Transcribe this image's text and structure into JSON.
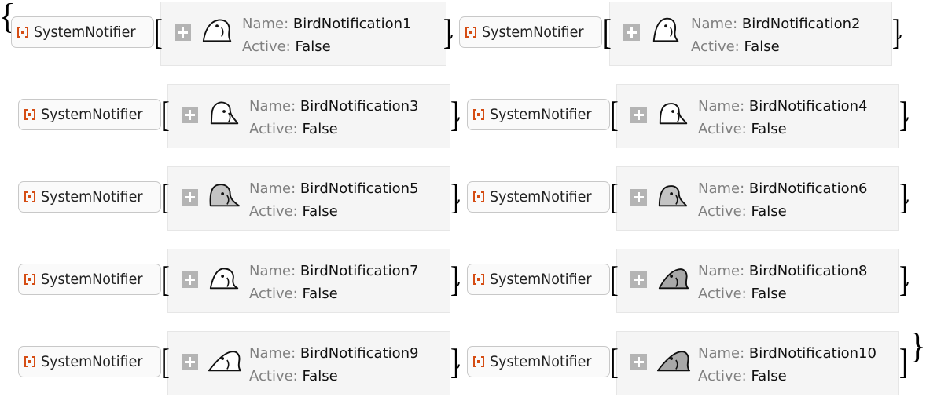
{
  "expression": {
    "open_brace": "{",
    "close_brace": "}",
    "open_bracket": "[",
    "close_bracket": "]",
    "separator": ","
  },
  "colors": {
    "notifier_icon": "#d54d14",
    "panel_background": "#f5f5f5",
    "field_key": "#808080",
    "expand_button": "#b4b4b4"
  },
  "notifiers": [
    {
      "head": "SystemNotifier",
      "name_key": "Name:",
      "name": "BirdNotification1",
      "active_key": "Active:",
      "active": "False",
      "icon": "bird-icon"
    },
    {
      "head": "SystemNotifier",
      "name_key": "Name:",
      "name": "BirdNotification2",
      "active_key": "Active:",
      "active": "False",
      "icon": "bird-icon"
    },
    {
      "head": "SystemNotifier",
      "name_key": "Name:",
      "name": "BirdNotification3",
      "active_key": "Active:",
      "active": "False",
      "icon": "bird-icon"
    },
    {
      "head": "SystemNotifier",
      "name_key": "Name:",
      "name": "BirdNotification4",
      "active_key": "Active:",
      "active": "False",
      "icon": "bird-icon"
    },
    {
      "head": "SystemNotifier",
      "name_key": "Name:",
      "name": "BirdNotification5",
      "active_key": "Active:",
      "active": "False",
      "icon": "bird-icon"
    },
    {
      "head": "SystemNotifier",
      "name_key": "Name:",
      "name": "BirdNotification6",
      "active_key": "Active:",
      "active": "False",
      "icon": "bird-icon"
    },
    {
      "head": "SystemNotifier",
      "name_key": "Name:",
      "name": "BirdNotification7",
      "active_key": "Active:",
      "active": "False",
      "icon": "bird-icon"
    },
    {
      "head": "SystemNotifier",
      "name_key": "Name:",
      "name": "BirdNotification8",
      "active_key": "Active:",
      "active": "False",
      "icon": "bird-icon"
    },
    {
      "head": "SystemNotifier",
      "name_key": "Name:",
      "name": "BirdNotification9",
      "active_key": "Active:",
      "active": "False",
      "icon": "bird-icon"
    },
    {
      "head": "SystemNotifier",
      "name_key": "Name:",
      "name": "BirdNotification10",
      "active_key": "Active:",
      "active": "False",
      "icon": "bird-icon"
    }
  ]
}
